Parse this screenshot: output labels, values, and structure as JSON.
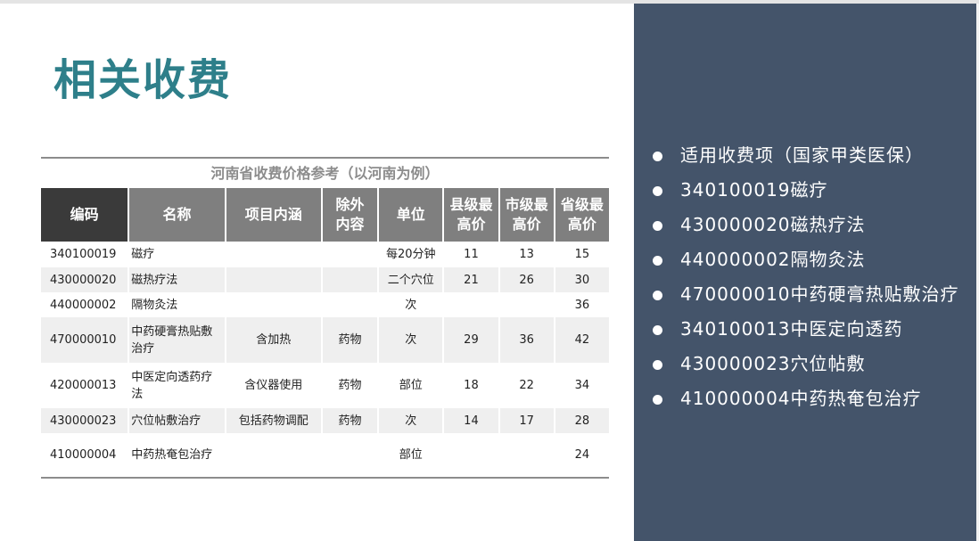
{
  "title": "相关收费",
  "table": {
    "caption": "河南省收费价格参考（以河南为例）",
    "headers": {
      "code": "编码",
      "name": "名称",
      "content": "项目内涵",
      "excluded_line1": "除外",
      "excluded_line2": "内容",
      "unit": "单位",
      "county_line1": "县级最",
      "county_line2": "高价",
      "city_line1": "市级最",
      "city_line2": "高价",
      "province_line1": "省级最",
      "province_line2": "高价"
    },
    "rows": [
      {
        "code": "340100019",
        "name": "磁疗",
        "content": "",
        "excluded": "",
        "unit": "每20分钟",
        "county": "11",
        "city": "13",
        "province": "15"
      },
      {
        "code": "430000020",
        "name": "磁热疗法",
        "content": "",
        "excluded": "",
        "unit": "二个穴位",
        "county": "21",
        "city": "26",
        "province": "30"
      },
      {
        "code": "440000002",
        "name": "隔物灸法",
        "content": "",
        "excluded": "",
        "unit": "次",
        "county": "",
        "city": "",
        "province": "36"
      },
      {
        "code": "470000010",
        "name": "中药硬膏热贴敷治疗",
        "content": "含加热",
        "excluded": "药物",
        "unit": "次",
        "county": "29",
        "city": "36",
        "province": "42"
      },
      {
        "code": "420000013",
        "name": "中医定向透药疗法",
        "content": "含仪器使用",
        "excluded": "药物",
        "unit": "部位",
        "county": "18",
        "city": "22",
        "province": "34"
      },
      {
        "code": "430000023",
        "name": "穴位帖敷治疗",
        "content": "包括药物调配",
        "excluded": "药物",
        "unit": "次",
        "county": "14",
        "city": "17",
        "province": "28"
      },
      {
        "code": "410000004",
        "name": "中药热奄包治疗",
        "content": "",
        "excluded": "",
        "unit": "部位",
        "county": "",
        "city": "",
        "province": "24"
      }
    ]
  },
  "bullets": [
    "适用收费项（国家甲类医保）",
    "340100019磁疗",
    "430000020磁热疗法",
    "440000002隔物灸法",
    "470000010中药硬膏热贴敷治疗",
    "340100013中医定向透药",
    "430000023穴位帖敷",
    "410000004中药热奄包治疗"
  ],
  "colors": {
    "title": "#2e7f8a",
    "panel": "#44546a",
    "header_dark": "#3a3a3a",
    "header_gray": "#7f7f7f"
  }
}
